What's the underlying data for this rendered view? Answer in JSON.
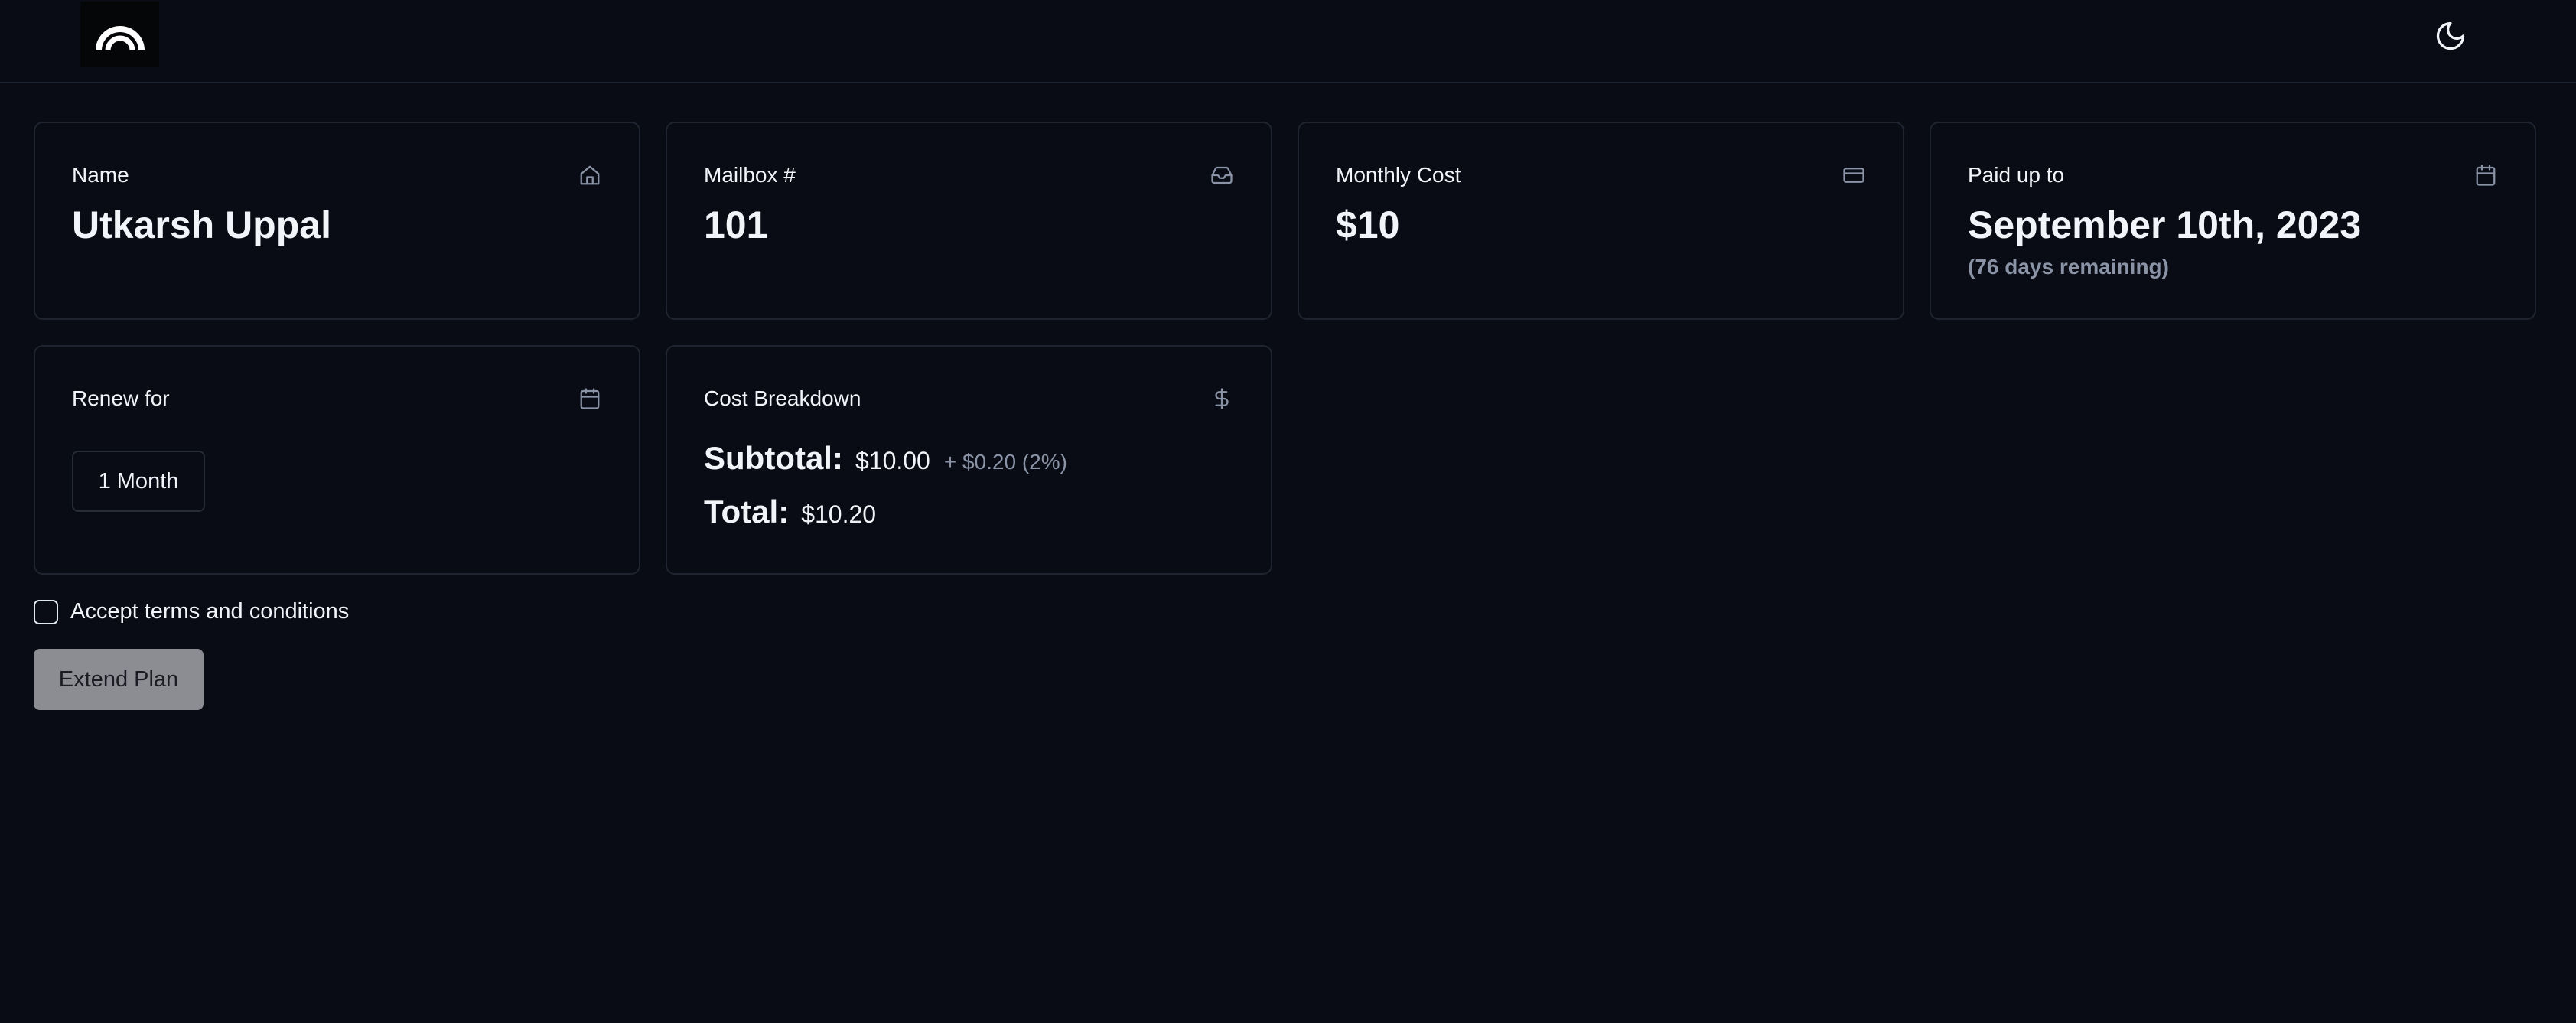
{
  "header": {
    "logo_icon": "arch-logo-icon",
    "theme_toggle_icon": "moon-icon"
  },
  "cards": {
    "name": {
      "title": "Name",
      "value": "Utkarsh Uppal",
      "icon": "home-icon"
    },
    "mailbox": {
      "title": "Mailbox #",
      "value": "101",
      "icon": "inbox-icon"
    },
    "monthly_cost": {
      "title": "Monthly Cost",
      "value": "$10",
      "icon": "credit-card-icon"
    },
    "paid_up_to": {
      "title": "Paid up to",
      "value": "September 10th, 2023",
      "sub": "(76 days remaining)",
      "icon": "calendar-icon"
    },
    "renew_for": {
      "title": "Renew for",
      "selected": "1 Month",
      "icon": "calendar-icon"
    },
    "cost_breakdown": {
      "title": "Cost Breakdown",
      "icon": "dollar-icon",
      "subtotal_label": "Subtotal:",
      "subtotal_value": "$10.00",
      "fee": "+ $0.20 (2%)",
      "total_label": "Total:",
      "total_value": "$10.20"
    }
  },
  "terms": {
    "label": "Accept terms and conditions",
    "checked": false
  },
  "actions": {
    "extend_label": "Extend Plan"
  },
  "colors": {
    "background": "#090c14",
    "border": "#1f2430",
    "muted": "#8a94a6",
    "button_disabled": "#8b8d93"
  }
}
